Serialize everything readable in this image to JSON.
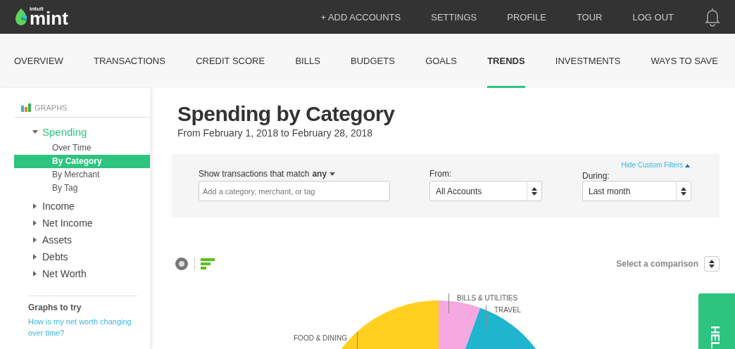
{
  "header": {
    "logo_small": "intuit",
    "logo": "mint",
    "links": [
      "+ ADD ACCOUNTS",
      "SETTINGS",
      "PROFILE",
      "TOUR",
      "LOG OUT"
    ]
  },
  "nav": [
    {
      "label": "OVERVIEW",
      "selected": false
    },
    {
      "label": "TRANSACTIONS",
      "selected": false
    },
    {
      "label": "CREDIT SCORE",
      "selected": false
    },
    {
      "label": "BILLS",
      "selected": false
    },
    {
      "label": "BUDGETS",
      "selected": false
    },
    {
      "label": "GOALS",
      "selected": false
    },
    {
      "label": "TRENDS",
      "selected": true
    },
    {
      "label": "INVESTMENTS",
      "selected": false
    },
    {
      "label": "WAYS TO SAVE",
      "selected": false
    }
  ],
  "sidebar": {
    "heading": "GRAPHS",
    "items": [
      {
        "label": "Spending",
        "expanded": true,
        "children": [
          {
            "label": "Over Time",
            "selected": false
          },
          {
            "label": "By Category",
            "selected": true
          },
          {
            "label": "By Merchant",
            "selected": false
          },
          {
            "label": "By Tag",
            "selected": false
          }
        ]
      },
      {
        "label": "Income",
        "expanded": false
      },
      {
        "label": "Net Income",
        "expanded": false
      },
      {
        "label": "Assets",
        "expanded": false
      },
      {
        "label": "Debts",
        "expanded": false
      },
      {
        "label": "Net Worth",
        "expanded": false
      }
    ],
    "graphs_to_try": {
      "heading": "Graphs to try",
      "link": "How is my net worth changing over time?"
    }
  },
  "main": {
    "title": "Spending by Category",
    "subtitle": "From February 1, 2018 to February 28, 2018",
    "filters": {
      "match_label": "Show transactions that match",
      "match_value": "any",
      "search_placeholder": "Add a category, merchant, or tag",
      "from_label": "From:",
      "from_value": "All Accounts",
      "during_label": "During:",
      "during_value": "Last month",
      "hide_link": "Hide Custom Filters"
    },
    "comparison": "Select a comparison",
    "pie_labels": [
      {
        "text": "BILLS & UTILITIES",
        "color": "#f6a8e0"
      },
      {
        "text": "TRAVEL",
        "color": "#1fb5cf"
      },
      {
        "text": "FOOD & DINING",
        "color": "#ffd020"
      }
    ]
  },
  "help_tab": "HEL"
}
